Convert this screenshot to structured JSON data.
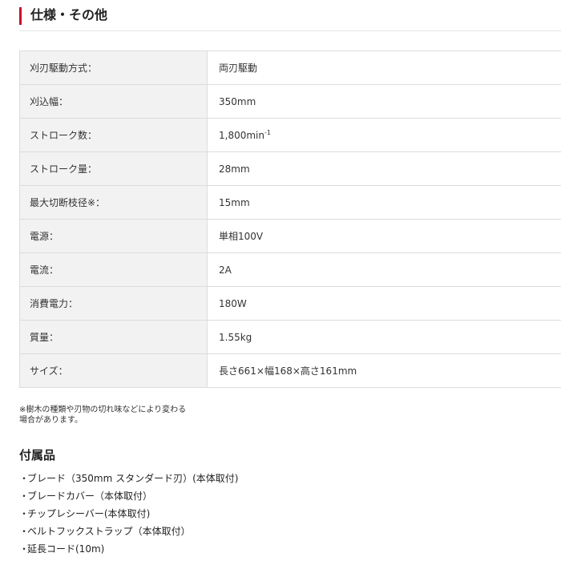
{
  "section": {
    "title": "仕様・その他",
    "accent_color": "#c8102e"
  },
  "specs": [
    {
      "label": "刈刃駆動方式：",
      "value": "両刃駆動"
    },
    {
      "label": "刈込幅：",
      "value": "350mm"
    },
    {
      "label": "ストローク数：",
      "value": "1,800min",
      "sup": "-1"
    },
    {
      "label": "ストローク量：",
      "value": "28mm"
    },
    {
      "label": "最大切断枝径※：",
      "value": "15mm"
    },
    {
      "label": "電源：",
      "value": "単相100V"
    },
    {
      "label": "電流：",
      "value": "2A"
    },
    {
      "label": "消費電力：",
      "value": "180W"
    },
    {
      "label": "質量：",
      "value": "1.55kg"
    },
    {
      "label": "サイズ：",
      "value": "長さ661×幅168×高さ161mm"
    }
  ],
  "note": {
    "line1": "※樹木の種類や刃物の切れ味などにより変わる",
    "line2": "場合があります。"
  },
  "accessories": {
    "title": "付属品",
    "bullet": "・",
    "items": [
      "ブレード（350mm スタンダード刃）(本体取付)",
      "ブレードカバー（本体取付）",
      "チップレシーバー(本体取付)",
      "ベルトフックストラップ（本体取付）",
      "延長コード(10m)"
    ]
  }
}
